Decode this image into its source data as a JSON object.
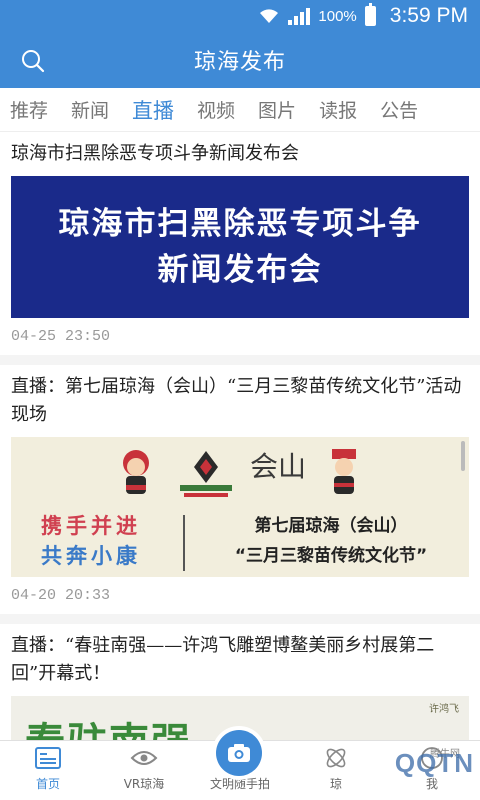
{
  "status_bar": {
    "battery_percent": "100%",
    "time": "3:59 PM"
  },
  "header": {
    "title": "琼海发布"
  },
  "tabs": [
    {
      "label": "推荐"
    },
    {
      "label": "新闻"
    },
    {
      "label": "直播",
      "active": true
    },
    {
      "label": "视频"
    },
    {
      "label": "图片"
    },
    {
      "label": "读报"
    },
    {
      "label": "公告"
    }
  ],
  "feed": [
    {
      "title": "琼海市扫黑除恶专项斗争新闻发布会",
      "banner_lines": [
        "琼海市扫黑除恶专项斗争",
        "新闻发布会"
      ],
      "time": "04-25  23:50"
    },
    {
      "title": "直播：第七届琼海（会山）“三月三黎苗传统文化节”活动现场",
      "banner_left_lines": [
        "携手并进",
        "共奔小康"
      ],
      "banner_right_lines": [
        "第七届琼海（会山）",
        "“三月三黎苗传统文化节”"
      ],
      "banner_logo_text": "会山",
      "time": "04-20  20:33"
    },
    {
      "title": "直播：“春驻南强——许鸿飞雕塑博鳌美丽乡村展第二回”开幕式！",
      "banner_text": "春驻南强",
      "banner_side_text": "许鸿飞"
    }
  ],
  "bottom_nav": [
    {
      "label": "首页",
      "icon": "home-icon",
      "active": true
    },
    {
      "label": "VR琼海",
      "icon": "eye-icon"
    },
    {
      "label": "文明随手拍",
      "icon": "camera-icon"
    },
    {
      "label": "琼",
      "icon": "atom-icon"
    },
    {
      "label": "我",
      "icon": "user-icon"
    }
  ],
  "watermark": "QQTN",
  "watermark_small": "腾牛网",
  "colors": {
    "brand": "#3f8ad6",
    "banner1_bg": "#1a2a8a"
  }
}
